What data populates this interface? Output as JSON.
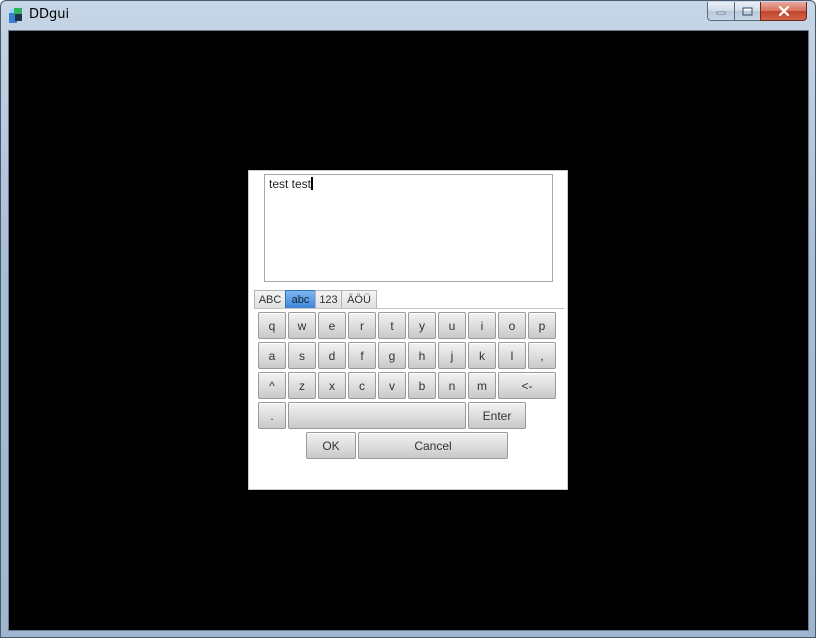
{
  "window": {
    "title": "DDgui",
    "icon": "ddgui-app-icon",
    "controls": [
      "minimize-icon",
      "maximize-icon",
      "close-icon"
    ]
  },
  "dialog": {
    "text_value": "test test",
    "tabs": [
      {
        "label": "ABC",
        "active": false
      },
      {
        "label": "abc",
        "active": true
      },
      {
        "label": "123",
        "active": false
      },
      {
        "label": "ÄÖÜ",
        "active": false
      }
    ],
    "rows": [
      [
        "q",
        "w",
        "e",
        "r",
        "t",
        "y",
        "u",
        "i",
        "o",
        "p"
      ],
      [
        "a",
        "s",
        "d",
        "f",
        "g",
        "h",
        "j",
        "k",
        "l",
        ","
      ],
      [
        "^",
        "z",
        "x",
        "c",
        "v",
        "b",
        "n",
        "m",
        "<-"
      ],
      [
        ".",
        "",
        "Enter"
      ]
    ],
    "ok_label": "OK",
    "cancel_label": "Cancel"
  },
  "colors": {
    "client_background": "#000000",
    "active_tab": "#3d86d9",
    "close_button": "#c2442c"
  }
}
